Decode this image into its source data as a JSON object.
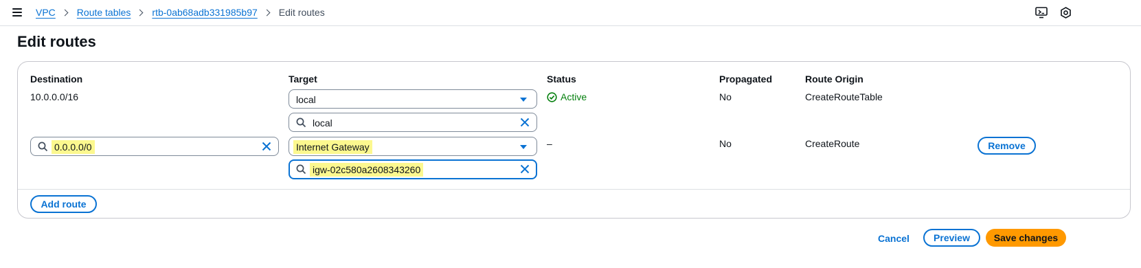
{
  "breadcrumb": {
    "items": [
      "VPC",
      "Route tables",
      "rtb-0ab68adb331985b97"
    ],
    "current": "Edit routes"
  },
  "header": {
    "icons": [
      "notifications-icon",
      "settings-icon"
    ]
  },
  "page": {
    "title": "Edit routes"
  },
  "table": {
    "columns": [
      "Destination",
      "Target",
      "Status",
      "Propagated",
      "Route Origin"
    ],
    "rows": [
      {
        "destination": "10.0.0.0/16",
        "target_type": "local",
        "target_search": "local",
        "status": "Active",
        "propagated": "No",
        "route_origin": "CreateRouteTable"
      },
      {
        "destination": "0.0.0.0/0",
        "target_type": "Internet Gateway",
        "target_search": "igw-02c580a2608343260",
        "status": "–",
        "propagated": "No",
        "route_origin": "CreateRoute",
        "remove_label": "Remove"
      }
    ]
  },
  "actions": {
    "add_route": "Add route",
    "cancel": "Cancel",
    "preview": "Preview",
    "save": "Save changes"
  },
  "colors": {
    "link": "#0972d3",
    "success": "#037f0c",
    "primary": "#ff9900",
    "highlight": "#fcf88f"
  }
}
